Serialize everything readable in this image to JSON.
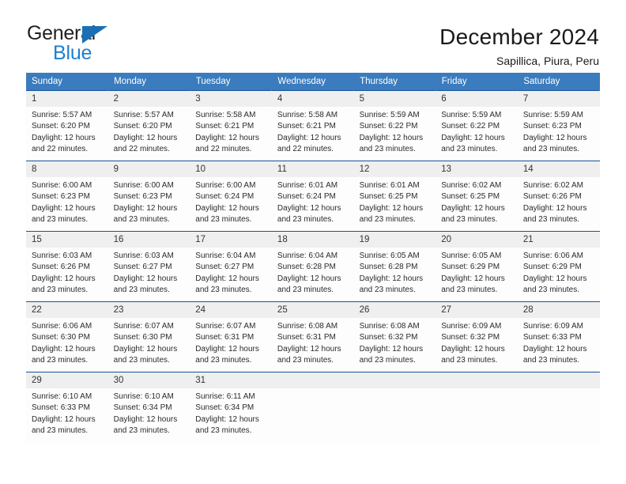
{
  "brand": {
    "name_primary": "General",
    "name_secondary": "Blue",
    "accent_color": "#1f7fd0",
    "triangle_color": "#1c6fb5"
  },
  "header": {
    "title": "December 2024",
    "subtitle": "Sapillica, Piura, Peru"
  },
  "calendar": {
    "header_bg": "#3a7cbd",
    "daynum_bg": "#efefef",
    "grid_line_color": "#17559b",
    "weekday_headers": [
      "Sunday",
      "Monday",
      "Tuesday",
      "Wednesday",
      "Thursday",
      "Friday",
      "Saturday"
    ],
    "weeks": [
      [
        {
          "day": "1",
          "sunrise": "Sunrise: 5:57 AM",
          "sunset": "Sunset: 6:20 PM",
          "daylight_1": "Daylight: 12 hours",
          "daylight_2": "and 22 minutes."
        },
        {
          "day": "2",
          "sunrise": "Sunrise: 5:57 AM",
          "sunset": "Sunset: 6:20 PM",
          "daylight_1": "Daylight: 12 hours",
          "daylight_2": "and 22 minutes."
        },
        {
          "day": "3",
          "sunrise": "Sunrise: 5:58 AM",
          "sunset": "Sunset: 6:21 PM",
          "daylight_1": "Daylight: 12 hours",
          "daylight_2": "and 22 minutes."
        },
        {
          "day": "4",
          "sunrise": "Sunrise: 5:58 AM",
          "sunset": "Sunset: 6:21 PM",
          "daylight_1": "Daylight: 12 hours",
          "daylight_2": "and 22 minutes."
        },
        {
          "day": "5",
          "sunrise": "Sunrise: 5:59 AM",
          "sunset": "Sunset: 6:22 PM",
          "daylight_1": "Daylight: 12 hours",
          "daylight_2": "and 23 minutes."
        },
        {
          "day": "6",
          "sunrise": "Sunrise: 5:59 AM",
          "sunset": "Sunset: 6:22 PM",
          "daylight_1": "Daylight: 12 hours",
          "daylight_2": "and 23 minutes."
        },
        {
          "day": "7",
          "sunrise": "Sunrise: 5:59 AM",
          "sunset": "Sunset: 6:23 PM",
          "daylight_1": "Daylight: 12 hours",
          "daylight_2": "and 23 minutes."
        }
      ],
      [
        {
          "day": "8",
          "sunrise": "Sunrise: 6:00 AM",
          "sunset": "Sunset: 6:23 PM",
          "daylight_1": "Daylight: 12 hours",
          "daylight_2": "and 23 minutes."
        },
        {
          "day": "9",
          "sunrise": "Sunrise: 6:00 AM",
          "sunset": "Sunset: 6:23 PM",
          "daylight_1": "Daylight: 12 hours",
          "daylight_2": "and 23 minutes."
        },
        {
          "day": "10",
          "sunrise": "Sunrise: 6:00 AM",
          "sunset": "Sunset: 6:24 PM",
          "daylight_1": "Daylight: 12 hours",
          "daylight_2": "and 23 minutes."
        },
        {
          "day": "11",
          "sunrise": "Sunrise: 6:01 AM",
          "sunset": "Sunset: 6:24 PM",
          "daylight_1": "Daylight: 12 hours",
          "daylight_2": "and 23 minutes."
        },
        {
          "day": "12",
          "sunrise": "Sunrise: 6:01 AM",
          "sunset": "Sunset: 6:25 PM",
          "daylight_1": "Daylight: 12 hours",
          "daylight_2": "and 23 minutes."
        },
        {
          "day": "13",
          "sunrise": "Sunrise: 6:02 AM",
          "sunset": "Sunset: 6:25 PM",
          "daylight_1": "Daylight: 12 hours",
          "daylight_2": "and 23 minutes."
        },
        {
          "day": "14",
          "sunrise": "Sunrise: 6:02 AM",
          "sunset": "Sunset: 6:26 PM",
          "daylight_1": "Daylight: 12 hours",
          "daylight_2": "and 23 minutes."
        }
      ],
      [
        {
          "day": "15",
          "sunrise": "Sunrise: 6:03 AM",
          "sunset": "Sunset: 6:26 PM",
          "daylight_1": "Daylight: 12 hours",
          "daylight_2": "and 23 minutes."
        },
        {
          "day": "16",
          "sunrise": "Sunrise: 6:03 AM",
          "sunset": "Sunset: 6:27 PM",
          "daylight_1": "Daylight: 12 hours",
          "daylight_2": "and 23 minutes."
        },
        {
          "day": "17",
          "sunrise": "Sunrise: 6:04 AM",
          "sunset": "Sunset: 6:27 PM",
          "daylight_1": "Daylight: 12 hours",
          "daylight_2": "and 23 minutes."
        },
        {
          "day": "18",
          "sunrise": "Sunrise: 6:04 AM",
          "sunset": "Sunset: 6:28 PM",
          "daylight_1": "Daylight: 12 hours",
          "daylight_2": "and 23 minutes."
        },
        {
          "day": "19",
          "sunrise": "Sunrise: 6:05 AM",
          "sunset": "Sunset: 6:28 PM",
          "daylight_1": "Daylight: 12 hours",
          "daylight_2": "and 23 minutes."
        },
        {
          "day": "20",
          "sunrise": "Sunrise: 6:05 AM",
          "sunset": "Sunset: 6:29 PM",
          "daylight_1": "Daylight: 12 hours",
          "daylight_2": "and 23 minutes."
        },
        {
          "day": "21",
          "sunrise": "Sunrise: 6:06 AM",
          "sunset": "Sunset: 6:29 PM",
          "daylight_1": "Daylight: 12 hours",
          "daylight_2": "and 23 minutes."
        }
      ],
      [
        {
          "day": "22",
          "sunrise": "Sunrise: 6:06 AM",
          "sunset": "Sunset: 6:30 PM",
          "daylight_1": "Daylight: 12 hours",
          "daylight_2": "and 23 minutes."
        },
        {
          "day": "23",
          "sunrise": "Sunrise: 6:07 AM",
          "sunset": "Sunset: 6:30 PM",
          "daylight_1": "Daylight: 12 hours",
          "daylight_2": "and 23 minutes."
        },
        {
          "day": "24",
          "sunrise": "Sunrise: 6:07 AM",
          "sunset": "Sunset: 6:31 PM",
          "daylight_1": "Daylight: 12 hours",
          "daylight_2": "and 23 minutes."
        },
        {
          "day": "25",
          "sunrise": "Sunrise: 6:08 AM",
          "sunset": "Sunset: 6:31 PM",
          "daylight_1": "Daylight: 12 hours",
          "daylight_2": "and 23 minutes."
        },
        {
          "day": "26",
          "sunrise": "Sunrise: 6:08 AM",
          "sunset": "Sunset: 6:32 PM",
          "daylight_1": "Daylight: 12 hours",
          "daylight_2": "and 23 minutes."
        },
        {
          "day": "27",
          "sunrise": "Sunrise: 6:09 AM",
          "sunset": "Sunset: 6:32 PM",
          "daylight_1": "Daylight: 12 hours",
          "daylight_2": "and 23 minutes."
        },
        {
          "day": "28",
          "sunrise": "Sunrise: 6:09 AM",
          "sunset": "Sunset: 6:33 PM",
          "daylight_1": "Daylight: 12 hours",
          "daylight_2": "and 23 minutes."
        }
      ],
      [
        {
          "day": "29",
          "sunrise": "Sunrise: 6:10 AM",
          "sunset": "Sunset: 6:33 PM",
          "daylight_1": "Daylight: 12 hours",
          "daylight_2": "and 23 minutes."
        },
        {
          "day": "30",
          "sunrise": "Sunrise: 6:10 AM",
          "sunset": "Sunset: 6:34 PM",
          "daylight_1": "Daylight: 12 hours",
          "daylight_2": "and 23 minutes."
        },
        {
          "day": "31",
          "sunrise": "Sunrise: 6:11 AM",
          "sunset": "Sunset: 6:34 PM",
          "daylight_1": "Daylight: 12 hours",
          "daylight_2": "and 23 minutes."
        },
        {
          "day": "",
          "sunrise": "",
          "sunset": "",
          "daylight_1": "",
          "daylight_2": "",
          "empty": true
        },
        {
          "day": "",
          "sunrise": "",
          "sunset": "",
          "daylight_1": "",
          "daylight_2": "",
          "empty": true
        },
        {
          "day": "",
          "sunrise": "",
          "sunset": "",
          "daylight_1": "",
          "daylight_2": "",
          "empty": true
        },
        {
          "day": "",
          "sunrise": "",
          "sunset": "",
          "daylight_1": "",
          "daylight_2": "",
          "empty": true
        }
      ]
    ]
  }
}
